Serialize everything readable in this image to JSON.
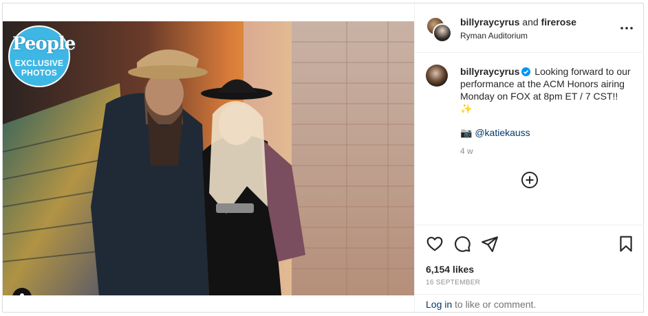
{
  "header": {
    "user1": "billyraycyrus",
    "and": "and",
    "user2": "firerose",
    "location": "Ryman Auditorium"
  },
  "badge": {
    "logo": "People",
    "line1": "EXCLUSIVE",
    "line2": "PHOTOS"
  },
  "caption": {
    "username": "billyraycyrus",
    "text": "Looking forward to our performance at the ACM Honors airing Monday on FOX at 8pm ET / 7 CST!! ✨",
    "mention_emoji": "📷",
    "mention": "@katiekauss",
    "time": "4 w"
  },
  "stats": {
    "likes": "6,154 likes",
    "date": "16 SEPTEMBER"
  },
  "footer": {
    "login": "Log in",
    "rest": " to like or comment."
  },
  "icons": {
    "more": "more-options-icon",
    "verified": "verified-badge-icon",
    "add": "add-comment-icon",
    "like": "heart-icon",
    "comment": "comment-icon",
    "share": "share-icon",
    "save": "bookmark-icon",
    "tag": "user-tag-icon"
  },
  "colors": {
    "link": "#00376b",
    "verified": "#0095f6",
    "badge": "#3fb7e5",
    "muted": "#8e8e8e"
  }
}
